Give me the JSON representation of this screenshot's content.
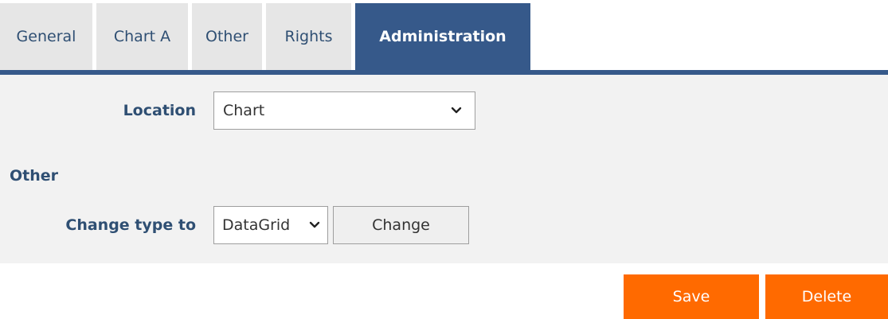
{
  "tabs": {
    "general": "General",
    "chart_a": "Chart A",
    "other": "Other",
    "rights": "Rights",
    "administration": "Administration"
  },
  "form": {
    "location_label": "Location",
    "location_value": "Chart",
    "section_other": "Other",
    "change_type_label": "Change type to",
    "change_type_value": "DataGrid",
    "change_button": "Change"
  },
  "actions": {
    "save": "Save",
    "delete": "Delete"
  },
  "colors": {
    "tab_active": "#36598a",
    "tab_inactive": "#e6e6e6",
    "text_blue": "#2f4f73",
    "button_orange": "#ff6a00"
  },
  "icons": {
    "dropdown": "chevron-down-icon"
  }
}
